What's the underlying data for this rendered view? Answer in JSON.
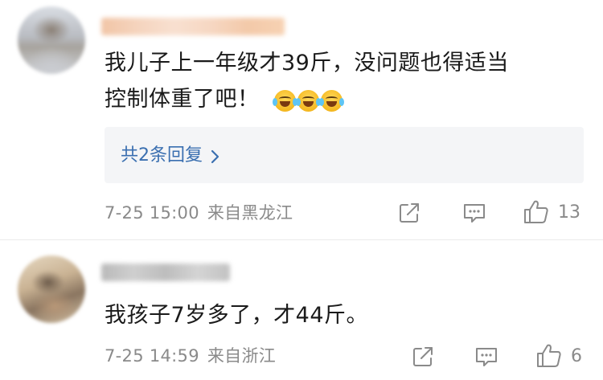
{
  "comments": [
    {
      "text_line1": "我儿子上一年级才39斤，没问题也得适当",
      "text_line2": "控制体重了吧！",
      "emoji": [
        "laugh-cry",
        "laugh-cry",
        "laugh-cry"
      ],
      "replies_label": "共2条回复",
      "time": "7-25 15:00",
      "location": "来自黑龙江",
      "likes": "13"
    },
    {
      "text": "我孩子7岁多了，才44斤。",
      "time": "7-25 14:59",
      "location": "来自浙江",
      "likes": "6"
    }
  ],
  "colors": {
    "link": "#3a6fb0",
    "meta": "#8a8a8a",
    "text": "#1a1a1a",
    "reply_box": "#f4f5f7"
  },
  "icons": [
    "share-icon",
    "comment-icon",
    "thumbs-up-icon",
    "chevron-right-icon"
  ]
}
